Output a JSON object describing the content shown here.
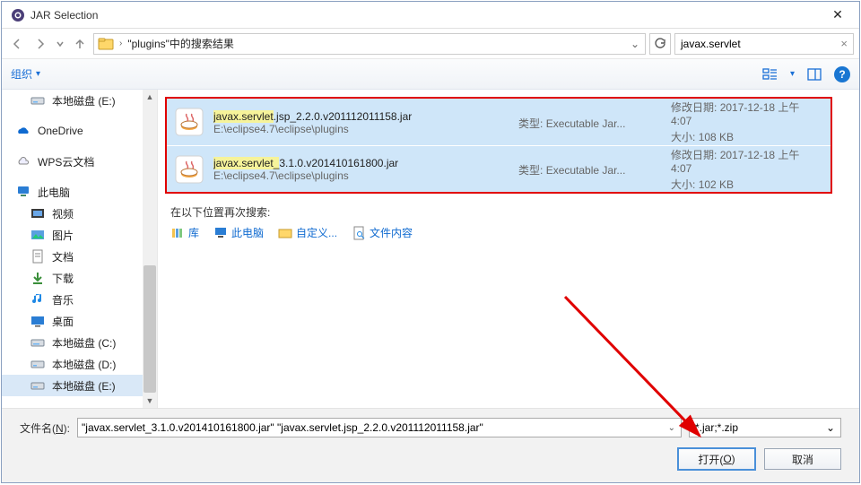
{
  "title": "JAR Selection",
  "breadcrumb": "\"plugins\"中的搜索结果",
  "search_value": "javax.servlet",
  "toolbar": {
    "organize": "组织"
  },
  "sidebar": {
    "items": [
      {
        "label": "本地磁盘 (E:)",
        "icon": "drive"
      },
      {
        "label": "OneDrive",
        "icon": "onedrive"
      },
      {
        "label": "WPS云文档",
        "icon": "wps"
      },
      {
        "label": "此电脑",
        "icon": "pc",
        "root": true
      },
      {
        "label": "视频",
        "icon": "video"
      },
      {
        "label": "图片",
        "icon": "pic"
      },
      {
        "label": "文档",
        "icon": "doc"
      },
      {
        "label": "下载",
        "icon": "dl"
      },
      {
        "label": "音乐",
        "icon": "music"
      },
      {
        "label": "桌面",
        "icon": "desk"
      },
      {
        "label": "本地磁盘 (C:)",
        "icon": "drive"
      },
      {
        "label": "本地磁盘 (D:)",
        "icon": "drive"
      },
      {
        "label": "本地磁盘 (E:)",
        "icon": "drive",
        "selected": true
      }
    ]
  },
  "results": [
    {
      "name_pre": "javax.servlet",
      "name_post": ".jsp_2.2.0.v201112011158.jar",
      "path": "E:\\eclipse4.7\\eclipse\\plugins",
      "type_label": "类型:",
      "type_value": "Executable Jar...",
      "mtime_label": "修改日期:",
      "mtime_value": "2017-12-18 上午 4:07",
      "size_label": "大小:",
      "size_value": "108 KB",
      "selected": true
    },
    {
      "name_pre": "javax.servlet_",
      "name_post": "3.1.0.v201410161800.jar",
      "path": "E:\\eclipse4.7\\eclipse\\plugins",
      "type_label": "类型:",
      "type_value": "Executable Jar...",
      "mtime_label": "修改日期:",
      "mtime_value": "2017-12-18 上午 4:07",
      "size_label": "大小:",
      "size_value": "102 KB",
      "selected": true
    }
  ],
  "search_again": {
    "header": "在以下位置再次搜索:",
    "options": [
      {
        "label": "库"
      },
      {
        "label": "此电脑"
      },
      {
        "label": "自定义..."
      },
      {
        "label": "文件内容"
      }
    ]
  },
  "filename": {
    "label_pre": "文件名(",
    "label_u": "N",
    "label_post": "):",
    "value": "\"javax.servlet_3.1.0.v201410161800.jar\" \"javax.servlet.jsp_2.2.0.v201112011158.jar\"",
    "filter": "*.jar;*.zip"
  },
  "buttons": {
    "open_pre": "打开(",
    "open_u": "O",
    "open_post": ")",
    "cancel": "取消"
  }
}
